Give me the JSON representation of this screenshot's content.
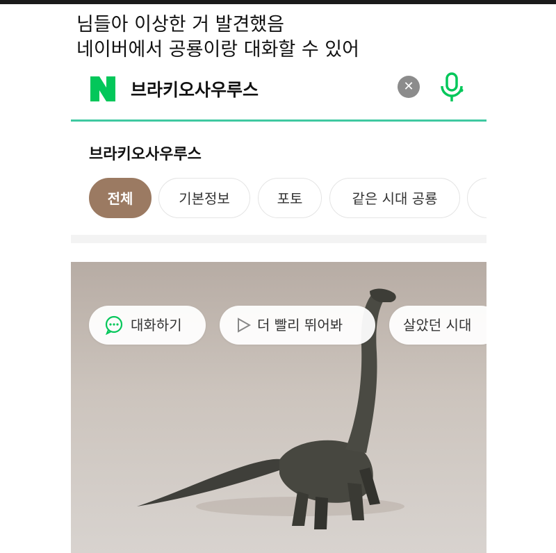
{
  "caption": {
    "line1": "님들아 이상한 거 발견했음",
    "line2": "네이버에서 공룡이랑 대화할 수 있어"
  },
  "search": {
    "logo": "N",
    "query": "브라키오사우루스",
    "clear_icon": "close-icon",
    "mic_icon": "microphone-icon"
  },
  "result": {
    "title": "브라키오사우루스",
    "tabs": [
      "전체",
      "기본정보",
      "포토",
      "같은 시대 공룡"
    ],
    "active_tab": "전체"
  },
  "actions": [
    {
      "label": "대화하기",
      "icon": "chat-bubble-icon"
    },
    {
      "label": "더 빨리 뛰어봐",
      "icon": "play-icon"
    },
    {
      "label": "살았던 시대"
    }
  ],
  "colors": {
    "naver_green": "#03c75a",
    "accent_teal": "#3ec8a0",
    "active_chip": "#9b7a62"
  }
}
